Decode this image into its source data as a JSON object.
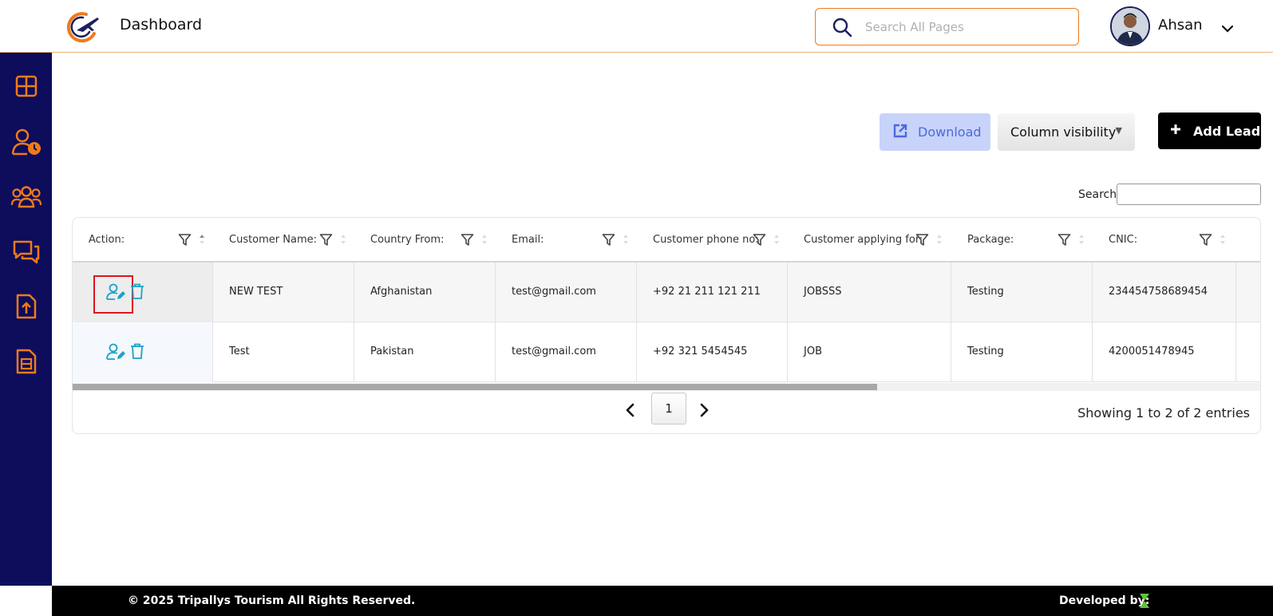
{
  "header": {
    "title": "Dashboard",
    "search_placeholder": "Search All Pages",
    "user_name": "Ahsan"
  },
  "toolbar": {
    "download_label": "Download",
    "column_visibility_label": "Column visibility",
    "add_lead_label": "Add Lead",
    "search_label": "Search:"
  },
  "table": {
    "columns": [
      "Action:",
      "Customer Name:",
      "Country From:",
      "Email:",
      "Customer phone no:",
      "Customer applying for:",
      "Package:",
      "CNIC:"
    ],
    "rows": [
      {
        "name": "NEW TEST",
        "country": "Afghanistan",
        "email": "test@gmail.com",
        "phone": "+92 21 211 121 211",
        "applying_for": "JOBSSS",
        "package": "Testing",
        "cnic": "234454758689454"
      },
      {
        "name": "Test",
        "country": "Pakistan",
        "email": "test@gmail.com",
        "phone": "+92 321 5454545",
        "applying_for": "JOB",
        "package": "Testing",
        "cnic": "4200051478945"
      }
    ]
  },
  "pagination": {
    "current_page": "1",
    "info": "Showing 1 to 2 of 2 entries"
  },
  "sidebar": {
    "icons": [
      "dashboard-grid-icon",
      "user-clock-icon",
      "users-group-icon",
      "chat-icon",
      "file-upload-icon",
      "document-icon"
    ]
  },
  "footer": {
    "copyright": "© 2025 Tripallys Tourism All Rights Reserved.",
    "developed_by": "Developed by:"
  },
  "colors": {
    "sidebar_bg": "#0d0d5c",
    "accent_orange": "#f07a1a",
    "download_bg": "#c8d3f9",
    "action_icon": "#1aa3c8",
    "highlight_red": "#e0131b"
  }
}
